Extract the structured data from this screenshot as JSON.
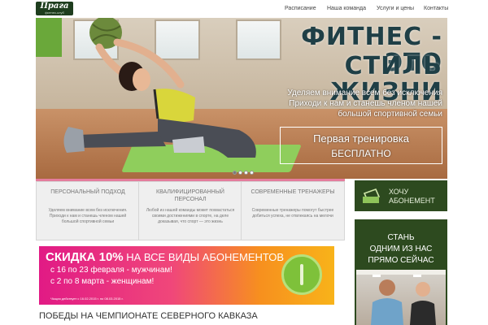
{
  "logo": {
    "name": "Прага",
    "tagline": "фитнес-клуб"
  },
  "nav": {
    "items": [
      "Расписание",
      "Наша команда",
      "Услуги и цены",
      "Контакты"
    ]
  },
  "hero": {
    "title_line1": "ФИТНЕС - ЭТО",
    "title_line2": "СТИЛЬ ЖИЗНИ",
    "subtitle_line1": "Уделяем внимание всем без исключения",
    "subtitle_line2": "Приходи к нам и станешь членом нашей",
    "subtitle_line3": "большой спортивной семьи",
    "cta_line1": "Первая тренировка",
    "cta_line2": "БЕСПЛАТНО",
    "slides_total": 4,
    "slide_active": 1
  },
  "features": [
    {
      "title": "Персональный подход",
      "desc": "Уделяем внимание всем без исключения. Приходи к нам и станешь членом нашей большой спортивной семьи"
    },
    {
      "title": "Квалифицированный персонал",
      "desc": "Любой из нашей команды может похвастаться своими достижениями в спорте, на деле доказывая, что спорт — это жизнь"
    },
    {
      "title": "Современные тренажеры",
      "desc": "Современные тренажеры помогут быстрее добиться успеха, не отвлекаясь на мелочи"
    }
  ],
  "sidebar": {
    "subscription_button": "ХОЧУ АБОНЕМЕНТ",
    "join_line1": "СТАНЬ",
    "join_line2": "ОДНИМ ИЗ НАС",
    "join_line3": "ПРЯМО СЕЙЧАС"
  },
  "promo": {
    "discount": "СКИДКА 10%",
    "rest": " НА ВСЕ ВИДЫ АБОНЕМЕНТОВ",
    "line2": "с 16 по 23 февраля - мужчинам!",
    "line3": "с 2 по 8 марта - женщинам!",
    "note": "*Акция действует с 16.02.2015 г. по 08.03.2015 г."
  },
  "section": {
    "title": "ПОБЕДЫ НА ЧЕМПИОНАТЕ СЕВЕРНОГО КАВКАЗА"
  },
  "colors": {
    "green": "#2d4a1f",
    "pink": "#e11a85",
    "orange": "#f8b31a",
    "title": "#1f3f46"
  }
}
